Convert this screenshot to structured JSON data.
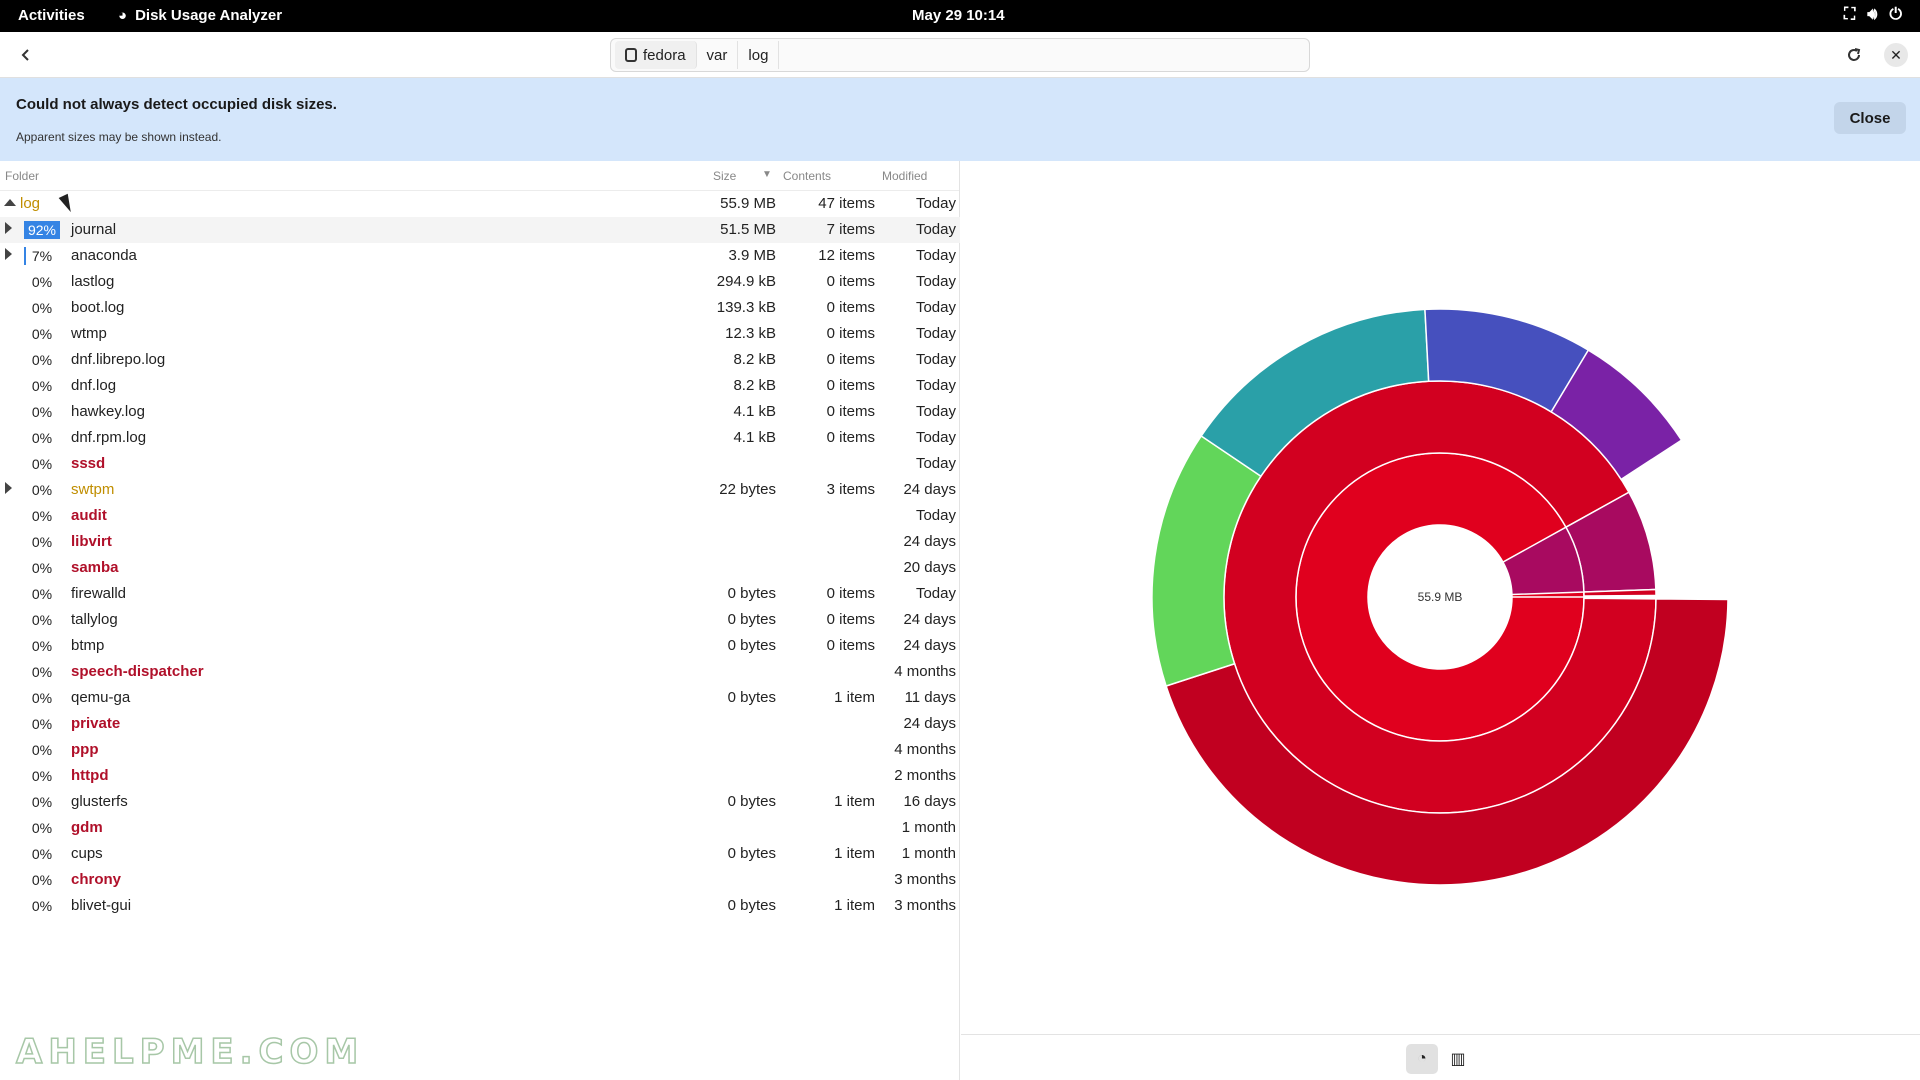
{
  "topbar": {
    "activities": "Activities",
    "app_name": "Disk Usage Analyzer",
    "clock": "May 29  10:14"
  },
  "pathbar": {
    "segments": [
      "fedora",
      "var",
      "log"
    ]
  },
  "banner": {
    "title": "Could not always detect occupied disk sizes.",
    "subtitle": "Apparent sizes may be shown instead.",
    "close_label": "Close"
  },
  "columns": {
    "folder": "Folder",
    "size": "Size",
    "contents": "Contents",
    "modified": "Modified"
  },
  "rows": [
    {
      "pct": "",
      "name": "log",
      "size": "55.9 MB",
      "contents": "47 items",
      "modified": "Today"
    },
    {
      "pct": "92%",
      "name": "journal",
      "size": "51.5 MB",
      "contents": "7 items",
      "modified": "Today"
    },
    {
      "pct": "7%",
      "name": "anaconda",
      "size": "3.9 MB",
      "contents": "12 items",
      "modified": "Today"
    },
    {
      "pct": "0%",
      "name": "lastlog",
      "size": "294.9 kB",
      "contents": "0 items",
      "modified": "Today"
    },
    {
      "pct": "0%",
      "name": "boot.log",
      "size": "139.3 kB",
      "contents": "0 items",
      "modified": "Today"
    },
    {
      "pct": "0%",
      "name": "wtmp",
      "size": "12.3 kB",
      "contents": "0 items",
      "modified": "Today"
    },
    {
      "pct": "0%",
      "name": "dnf.librepo.log",
      "size": "8.2 kB",
      "contents": "0 items",
      "modified": "Today"
    },
    {
      "pct": "0%",
      "name": "dnf.log",
      "size": "8.2 kB",
      "contents": "0 items",
      "modified": "Today"
    },
    {
      "pct": "0%",
      "name": "hawkey.log",
      "size": "4.1 kB",
      "contents": "0 items",
      "modified": "Today"
    },
    {
      "pct": "0%",
      "name": "dnf.rpm.log",
      "size": "4.1 kB",
      "contents": "0 items",
      "modified": "Today"
    },
    {
      "pct": "0%",
      "name": "sssd",
      "size": "",
      "contents": "",
      "modified": "Today"
    },
    {
      "pct": "0%",
      "name": "swtpm",
      "size": "22 bytes",
      "contents": "3 items",
      "modified": "24 days"
    },
    {
      "pct": "0%",
      "name": "audit",
      "size": "",
      "contents": "",
      "modified": "Today"
    },
    {
      "pct": "0%",
      "name": "libvirt",
      "size": "",
      "contents": "",
      "modified": "24 days"
    },
    {
      "pct": "0%",
      "name": "samba",
      "size": "",
      "contents": "",
      "modified": "20 days"
    },
    {
      "pct": "0%",
      "name": "firewalld",
      "size": "0 bytes",
      "contents": "0 items",
      "modified": "Today"
    },
    {
      "pct": "0%",
      "name": "tallylog",
      "size": "0 bytes",
      "contents": "0 items",
      "modified": "24 days"
    },
    {
      "pct": "0%",
      "name": "btmp",
      "size": "0 bytes",
      "contents": "0 items",
      "modified": "24 days"
    },
    {
      "pct": "0%",
      "name": "speech-dispatcher",
      "size": "",
      "contents": "",
      "modified": "4 months"
    },
    {
      "pct": "0%",
      "name": "qemu-ga",
      "size": "0 bytes",
      "contents": "1 item",
      "modified": "11 days"
    },
    {
      "pct": "0%",
      "name": "private",
      "size": "",
      "contents": "",
      "modified": "24 days"
    },
    {
      "pct": "0%",
      "name": "ppp",
      "size": "",
      "contents": "",
      "modified": "4 months"
    },
    {
      "pct": "0%",
      "name": "httpd",
      "size": "",
      "contents": "",
      "modified": "2 months"
    },
    {
      "pct": "0%",
      "name": "glusterfs",
      "size": "0 bytes",
      "contents": "1 item",
      "modified": "16 days"
    },
    {
      "pct": "0%",
      "name": "gdm",
      "size": "",
      "contents": "",
      "modified": "1 month"
    },
    {
      "pct": "0%",
      "name": "cups",
      "size": "0 bytes",
      "contents": "1 item",
      "modified": "1 month"
    },
    {
      "pct": "0%",
      "name": "chrony",
      "size": "",
      "contents": "",
      "modified": "3 months"
    },
    {
      "pct": "0%",
      "name": "blivet-gui",
      "size": "0 bytes",
      "contents": "1 item",
      "modified": "3 months"
    }
  ],
  "ring_chart": {
    "center_label": "55.9 MB",
    "colors": {
      "root": "#e0001e",
      "level1": "#d20020",
      "level2_large": "#c10020",
      "teal": "#2aa0a8",
      "blue": "#4650be",
      "purple": "#7a22a6",
      "green": "#62d65a",
      "magenta": "#a80a60"
    }
  },
  "watermark": "AHELPME.COM"
}
